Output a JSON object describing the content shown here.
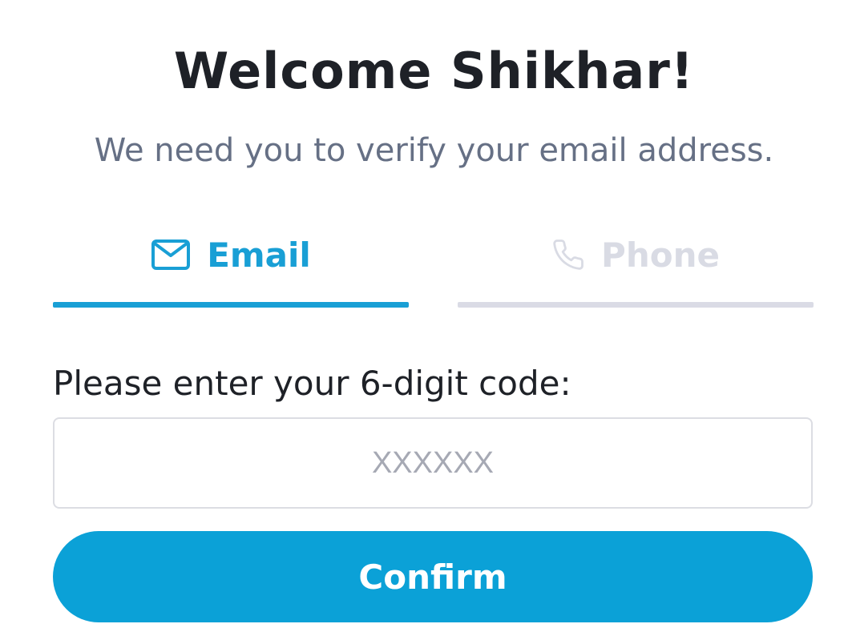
{
  "header": {
    "title": "Welcome Shikhar!",
    "subtitle": "We need you to verify your email address."
  },
  "tabs": [
    {
      "label": "Email",
      "icon": "mail-icon",
      "active": true
    },
    {
      "label": "Phone",
      "icon": "phone-icon",
      "active": false
    }
  ],
  "form": {
    "code_label": "Please enter your 6-digit code:",
    "code_value": "",
    "code_placeholder": "XXXXXX",
    "confirm_label": "Confirm"
  },
  "colors": {
    "accent": "#0ba1d7",
    "active_tab": "#199fd5",
    "inactive_tab": "#d9dbe4",
    "title_text": "#1e2127",
    "subtitle_text": "#667085"
  }
}
